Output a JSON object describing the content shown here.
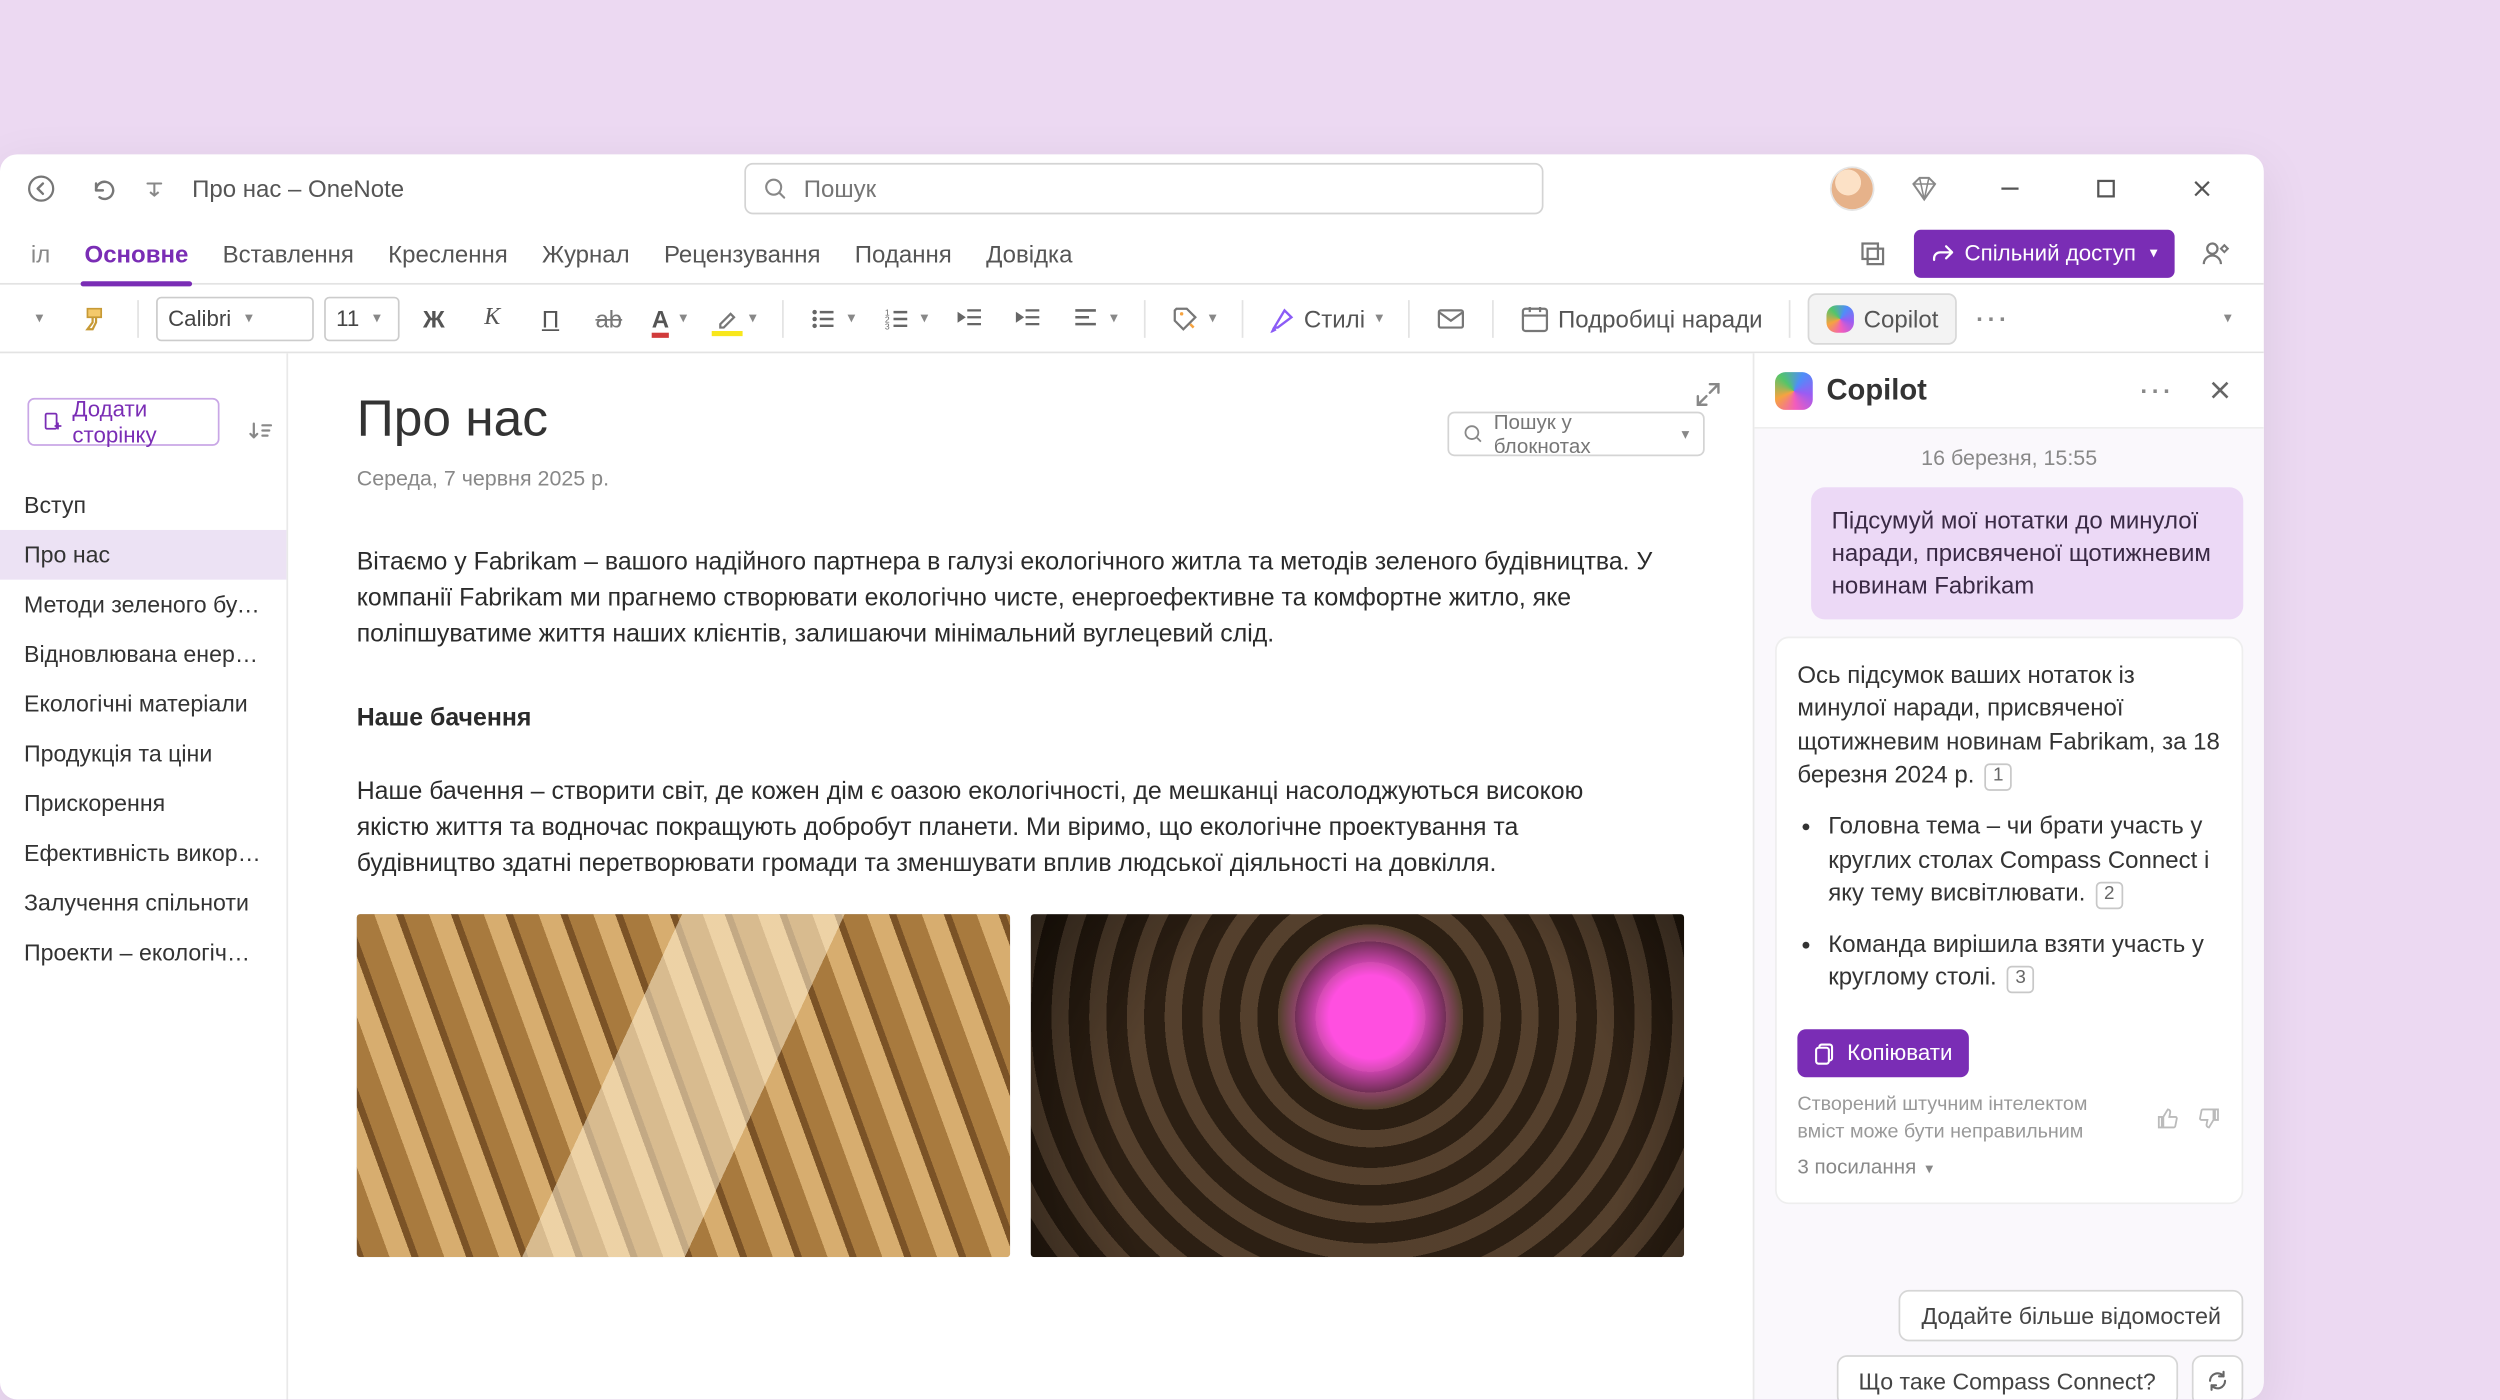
{
  "window": {
    "title": "Про нас – OneNote"
  },
  "search": {
    "placeholder": "Пошук"
  },
  "tabs": {
    "truncated_first": "іл",
    "items": [
      "Основне",
      "Вставлення",
      "Креслення",
      "Журнал",
      "Рецензування",
      "Подання",
      "Довідка"
    ],
    "active_index": 0,
    "share_label": "Спільний доступ"
  },
  "ribbon": {
    "font_name": "Calibri",
    "font_size": "11",
    "styles_label": "Стилі",
    "meeting_details_label": "Подробиці наради",
    "copilot_label": "Copilot"
  },
  "notebook_search": {
    "placeholder": "Пошук у блокнотах"
  },
  "nav": {
    "add_page_label": "Додати сторінку",
    "items": [
      "Вступ",
      "Про нас",
      "Методи зеленого будів…",
      "Відновлювана енергія…",
      "Екологічні матеріали",
      "Продукція та ціни",
      "Прискорення",
      "Ефективність використ…",
      "Залучення спільноти",
      "Проекти – екологічний …"
    ],
    "active_index": 1
  },
  "page": {
    "title": "Про нас",
    "date": "Середа, 7 червня 2025 р.",
    "intro": "Вітаємо у Fabrikam – вашого надійного партнера в галузі екологічного житла та методів зеленого будівництва. У компанії Fabrikam ми прагнемо створювати екологічно чисте, енергоефективне та комфортне житло, яке поліпшуватиме життя наших клієнтів, залишаючи мінімальний вуглецевий слід.",
    "vision_h": "Наше бачення",
    "vision_p": "Наше бачення – створити світ, де кожен дім є оазою екологічності, де мешканці насолоджуються високою якістю життя та водночас покращують добробут планети. Ми віримо, що екологічне проектування та будівництво здатні перетворювати громади та зменшувати вплив людської діяльності на довкілля."
  },
  "copilot": {
    "title": "Copilot",
    "timestamp": "16 березня, 15:55",
    "user_msg": "Підсумуй мої нотатки до минулої наради, присвяченої щотижневим новинам Fabrikam",
    "assistant_intro": "Ось підсумок ваших нотаток із минулої наради, присвяченої щотижневим новинам Fabrikam, за 18 березня 2024 р.",
    "ref_intro": "1",
    "bullets": [
      {
        "text": "Головна тема – чи брати участь у круглих столах Compass Connect і яку тему висвітлювати.",
        "ref": "2"
      },
      {
        "text": "Команда вирішила взяти участь у круглому столі.",
        "ref": "3"
      }
    ],
    "copy_label": "Копіювати",
    "ai_disclaimer": "Створений штучним інтелектом вміст може бути неправильним",
    "refs_toggle": "3 посилання",
    "suggestions": [
      "Додайте більше відомостей",
      "Що таке Compass Connect?"
    ]
  }
}
